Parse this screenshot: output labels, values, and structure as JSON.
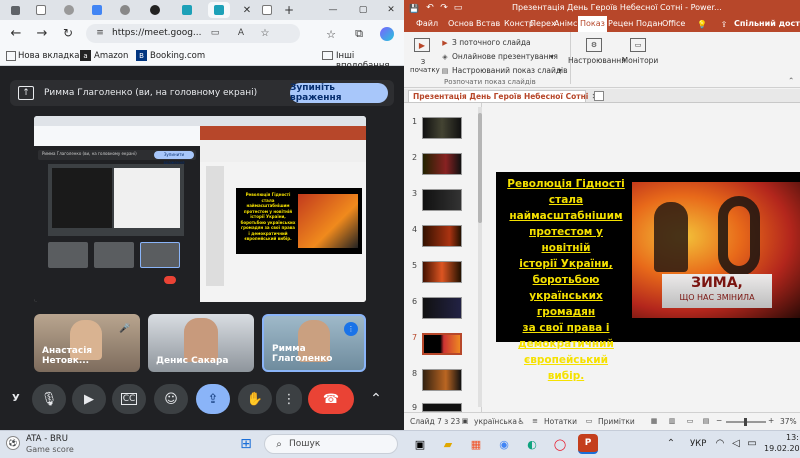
{
  "browser": {
    "url": "https://meet.goog...",
    "bookmarks": [
      "Нова вкладка",
      "Amazon",
      "Booking.com"
    ],
    "bookmarks_other": "Інші вподобання",
    "presenting_text": "Римма Глаголенко (ви, на головному екрані)",
    "stop_label": "Зупиніть враження",
    "preview_presenting_text": "Римма Глаголенко (ви, на головному екрані)",
    "preview_stop_label": "Зупинити враження"
  },
  "participants": [
    {
      "name": "Анастасія Нетовк..."
    },
    {
      "name": "Денис Сакара"
    },
    {
      "name": "Римма Глаголенко"
    }
  ],
  "controls_left_label": "У",
  "ppt": {
    "window_title": "Презентація День Героїв Небесної Сотні - Power...",
    "tabs": [
      "Файл",
      "Основ",
      "Встав",
      "Констр",
      "Перех",
      "Анімс",
      "Показ",
      "Рецен",
      "Подан",
      "Office"
    ],
    "active_tab": "Показ",
    "share_label": "Спільний дост",
    "ribbon": {
      "from_beginning": "З початку",
      "from_current": "З поточного слайда",
      "online": "Онлайнове презентування",
      "custom": "Настроюваний показ слайдів",
      "group_label": "Розпочати показ слайдів",
      "setup": "Настроювання",
      "monitors": "Монітори"
    },
    "doc_tab": "Презентація День Героїв Небесної Сотні",
    "thumb_numbers": [
      "1",
      "2",
      "3",
      "4",
      "5",
      "6",
      "7",
      "8",
      "9"
    ],
    "slide_text": "Революція Гідності стала наймасштабнішим протестом у новітній історії України, боротьбою українських громадян за свої права і демократичний європейський вибір.",
    "slide_text_lines": [
      "Революція Гідності",
      "стала",
      "наймасштабнішим",
      "протестом у новітній",
      "історії України,",
      "боротьбою",
      "українських громадян",
      "за свої права і",
      "демократичний",
      "європейський вибір."
    ],
    "slide_banner_main": "ЗИМА,",
    "slide_banner_sub": "ЩО НАС ЗМІНИЛА",
    "status_slide": "Слайд 7 з 23",
    "status_lang": "українська",
    "status_notes": "Нотатки",
    "status_comments": "Примітки",
    "zoom": "37%"
  },
  "taskbar": {
    "widget_title": "ATA - BRU",
    "widget_sub": "Game score",
    "search_placeholder": "Пошук",
    "lang": "УКР",
    "time": "13:",
    "date": "19.02.202"
  },
  "colors": {
    "ppt_accent": "#b7472a",
    "meet_stop": "#a8c7fa",
    "end_call": "#ea4335",
    "slide_text": "#f5e100"
  }
}
